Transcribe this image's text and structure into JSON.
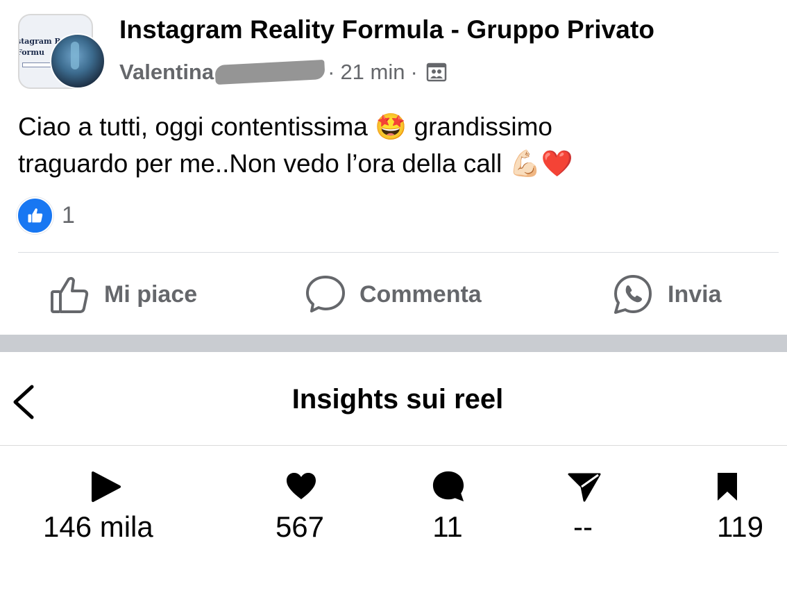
{
  "post": {
    "group_name": "Instagram Reality Formula - Gruppo Privato",
    "group_logo_text": "stagram Re Formu",
    "author": "Valentina",
    "time": "21 min",
    "separator": "·",
    "privacy_icon": "members-group-icon",
    "text_line1": "Ciao a tutti, oggi contentissima 🤩 grandissimo",
    "text_line2": "traguardo per me..Non vedo l’ora della call 💪🏻❤️",
    "reaction_icon": "like-icon",
    "reaction_count": "1",
    "actions": {
      "like_label": "Mi piace",
      "comment_label": "Commenta",
      "send_label": "Invia"
    }
  },
  "insights": {
    "title": "Insights sui reel",
    "back_icon": "chevron-left-icon",
    "stats": [
      {
        "icon": "play-icon",
        "value": "146 mila"
      },
      {
        "icon": "heart-icon",
        "value": "567"
      },
      {
        "icon": "comment-bubble-icon",
        "value": "11"
      },
      {
        "icon": "send-arrow-icon",
        "value": "--"
      },
      {
        "icon": "bookmark-icon",
        "value": "119"
      }
    ]
  },
  "colors": {
    "facebook_blue": "#1877f2",
    "secondary_text": "#65676b",
    "separator_band": "#c9ccd1"
  }
}
